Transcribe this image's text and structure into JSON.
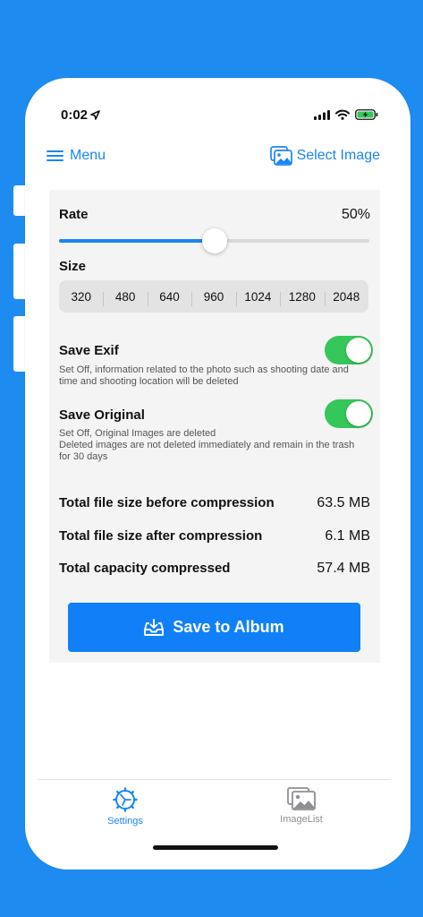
{
  "status_bar": {
    "time": "0:02"
  },
  "nav": {
    "menu_label": "Menu",
    "select_image_label": "Select Image"
  },
  "rate": {
    "label": "Rate",
    "value_text": "50%",
    "slider_fraction": 0.5
  },
  "size": {
    "label": "Size",
    "options": [
      "320",
      "480",
      "640",
      "960",
      "1024",
      "1280",
      "2048"
    ]
  },
  "save_exif": {
    "label": "Save Exif",
    "enabled": true,
    "description": "Set Off, information related to the photo such as shooting date and time and shooting location will be deleted"
  },
  "save_original": {
    "label": "Save Original",
    "enabled": true,
    "description_line1": "Set Off, Original Images are deleted",
    "description_line2": "Deleted images are not deleted immediately and remain in the trash for 30 days"
  },
  "stats": [
    {
      "label": "Total file size before compression",
      "value": "63.5 MB"
    },
    {
      "label": "Total file size after compression",
      "value": "6.1 MB"
    },
    {
      "label": "Total capacity compressed",
      "value": "57.4 MB"
    }
  ],
  "save_button": {
    "label": "Save to Album"
  },
  "tabs": [
    {
      "label": "Settings",
      "active": true
    },
    {
      "label": "ImageList",
      "active": false
    }
  ],
  "colors": {
    "accent": "#1A86F2",
    "toggle_on": "#35C759",
    "background": "#1E8BF0",
    "inactive_tab": "#8E8E93"
  }
}
